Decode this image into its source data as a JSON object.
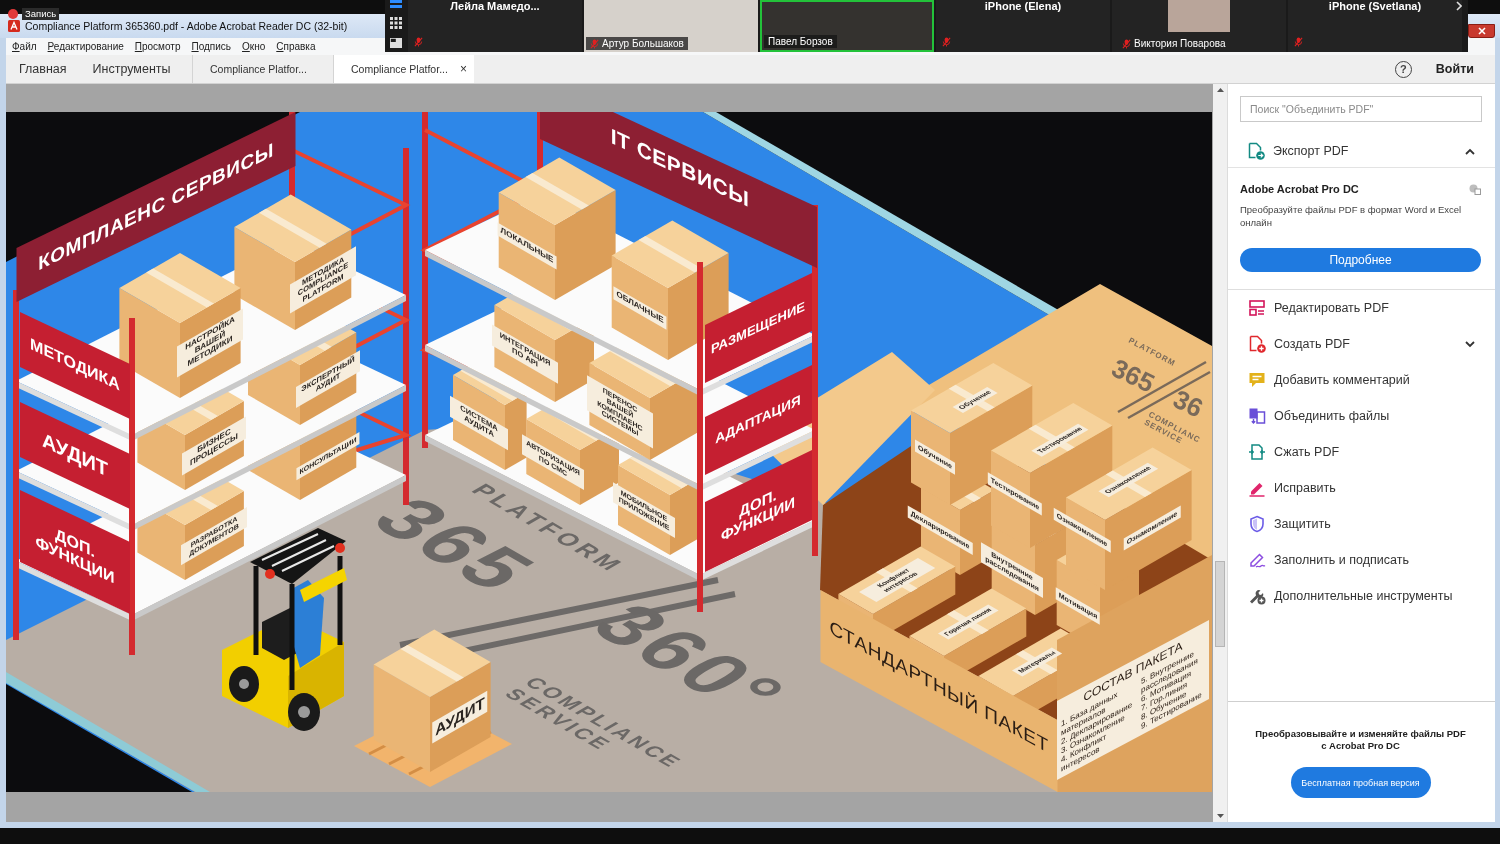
{
  "recording": {
    "label": "Запись"
  },
  "window": {
    "title": "Compliance Platform 365360.pdf - Adobe Acrobat Reader DC (32-bit)"
  },
  "menu": [
    {
      "label": "Файл"
    },
    {
      "label": "Редактирование"
    },
    {
      "label": "Просмотр"
    },
    {
      "label": "Подпись"
    },
    {
      "label": "Окно"
    },
    {
      "label": "Справка"
    }
  ],
  "meeting": {
    "participants": [
      {
        "name": "Лейла Мамедо...",
        "kind": "none",
        "muted": true,
        "speaking": false
      },
      {
        "name": "Артур Большаков",
        "kind": "video",
        "muted": true,
        "speaking": false
      },
      {
        "name": "Павел Борзов",
        "kind": "video",
        "muted": false,
        "speaking": true
      },
      {
        "name": "iPhone (Elena)",
        "kind": "none",
        "muted": true,
        "speaking": false
      },
      {
        "name": "Виктория Поварова",
        "kind": "avatar",
        "muted": true,
        "speaking": false
      },
      {
        "name": "iPhone (Svetlana)",
        "kind": "none",
        "muted": true,
        "speaking": false
      }
    ]
  },
  "tabs": [
    {
      "label": "Главная",
      "kind": "nav",
      "selected": false
    },
    {
      "label": "Инструменты",
      "kind": "nav",
      "selected": false
    },
    {
      "label": "Compliance Platfor...",
      "kind": "document",
      "selected": false
    },
    {
      "label": "Compliance Platfor...",
      "kind": "document",
      "selected": true,
      "close": "×"
    }
  ],
  "header": {
    "help": "?",
    "sign_in": "Войти"
  },
  "illustration": {
    "banners": [
      "КОМПЛАЕНС СЕРВИСЫ",
      "IT СЕРВИСЫ"
    ],
    "side_signs": [
      "МЕТОДИКА",
      "АУДИТ",
      "ДОП. ФУНКЦИИ",
      "РАЗМЕЩЕНИЕ",
      "АДАПТАЦИЯ",
      "ДОП. ФУНКЦИИ"
    ],
    "boxes": [
      "НАСТРОЙКА ВАШЕЙ МЕТОДИКИ",
      "МЕТОДИКА COMPLIANCE PLATFORM",
      "ЭКСПЕРТНЫЙ АУДИТ",
      "БИЗНЕС ПРОЦЕССЫ",
      "КОНСУЛЬТАЦИИ",
      "РАЗРАБОТКА ДОКУМЕНТОВ",
      "ЛОКАЛЬНЫЕ",
      "ОБЛАЧНЫЕ",
      "ИНТЕГРАЦИЯ ПО API",
      "ПЕРЕНОС ВАШЕЙ КОМПЛАЕНС СИСТЕМЫ",
      "СИСТЕМА АУДИТА",
      "АВТОРИЗАЦИЯ ПО СМС",
      "МОБИЛЬНОЕ ПРИЛОЖЕНИЕ",
      "АУДИТ"
    ],
    "floor_marks": [
      "PLATFORM",
      "365",
      "360°",
      "COMPLIANCE SERVICE"
    ],
    "package": {
      "title": "СТАНДАРТНЫЙ ПАКЕТ",
      "contents_title": "СОСТАВ ПАКЕТА",
      "contents": [
        "1. База данных материалов",
        "2. Декларирование",
        "3. Ознакомление",
        "4. Конфликт интересов",
        "5. Внутренние расследования",
        "6. Мотивация",
        "7. Гор.линия",
        "8. Обучение",
        "9. Тестирование"
      ],
      "flap_logo": [
        "PLATFORM",
        "365",
        "36",
        "COMPLIANC SERVICE"
      ],
      "box_labels": [
        "Обучение",
        "Обучение",
        "Тестирование",
        "Тестирование",
        "Ознакомление",
        "Ознакомление",
        "Ознакомление",
        "Декларирование",
        "Внутренние расследования",
        "Мотивация",
        "Конфликт интересов",
        "Горячая линия",
        "Материалы"
      ]
    }
  },
  "tools_panel": {
    "search": {
      "placeholder": "Поиск \"Объединить PDF\""
    },
    "export": {
      "label": "Экспорт PDF",
      "expanded": true,
      "product": "Adobe Acrobat Pro DC",
      "description": "Преобразуйте файлы PDF в формат Word и Excel онлайн",
      "button": "Подробнее"
    },
    "tools": [
      {
        "label": "Редактировать PDF",
        "kind": "edit",
        "expandable": false
      },
      {
        "label": "Создать PDF",
        "kind": "create",
        "expandable": true
      },
      {
        "label": "Добавить комментарий",
        "kind": "comment",
        "expandable": false
      },
      {
        "label": "Объединить файлы",
        "kind": "combine",
        "expandable": false
      },
      {
        "label": "Сжать PDF",
        "kind": "compress",
        "expandable": false
      },
      {
        "label": "Исправить",
        "kind": "fix",
        "expandable": false
      },
      {
        "label": "Защитить",
        "kind": "protect",
        "expandable": false
      },
      {
        "label": "Заполнить и подписать",
        "kind": "fill_sign",
        "expandable": false
      },
      {
        "label": "Дополнительные инструменты",
        "kind": "more",
        "expandable": false
      }
    ],
    "promo": {
      "text": "Преобразовывайте и изменяйте файлы PDF с Acrobat Pro DC",
      "button": "Бесплатная пробная версия"
    }
  }
}
